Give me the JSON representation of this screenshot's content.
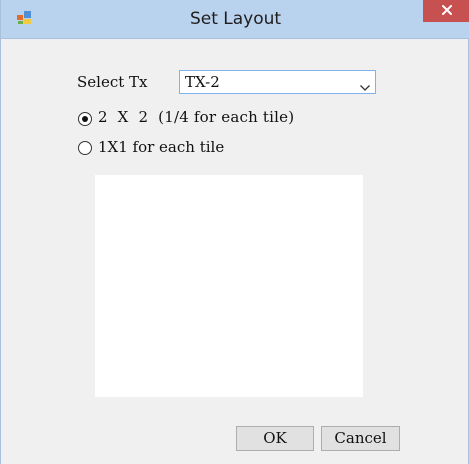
{
  "window": {
    "title": "Set Layout"
  },
  "form": {
    "select_tx_label": "Select Tx",
    "select_tx_value": "TX-2",
    "options": [
      {
        "label": "2  X  2  (1/4 for each tile)",
        "selected": true
      },
      {
        "label": "1X1 for each tile",
        "selected": false
      }
    ]
  },
  "buttons": {
    "ok_label": "OK",
    "cancel_label": "Cancel"
  },
  "icons": {
    "app": "app-icon",
    "close": "close-icon",
    "dropdown": "chevron-down-icon"
  },
  "colors": {
    "titlebar": "#b9d2ed",
    "close_button": "#c75050",
    "dialog_background": "#f0f0f0",
    "combo_border": "#7eb4ea",
    "button_face": "#e1e1e1"
  }
}
